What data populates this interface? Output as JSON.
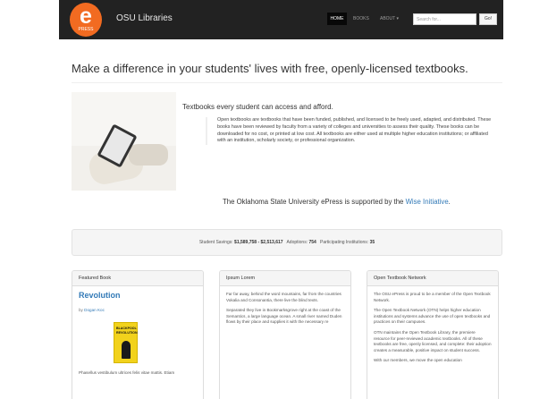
{
  "navbar": {
    "logo_letter": "e",
    "logo_sub": "PRESS",
    "brand": "OSU Libraries",
    "links": [
      "HOME",
      "BOOKS",
      "ABOUT ▾"
    ],
    "search_placeholder": "Search for...",
    "search_button": "Go!",
    "colors": {
      "bar": "#222222",
      "logo": "#f26b21"
    }
  },
  "hero": {
    "headline": "Make a difference in your students' lives with free, openly-licensed textbooks.",
    "subheading": "Textbooks every student can access and afford.",
    "description": "Open textbooks are textbooks that have been funded, published, and licensed to be freely used, adapted, and distributed. These books have been reviewed by faculty from a variety of colleges and universities to assess their quality. These books can be downloaded for no cost, or printed at low cost. All textbooks are either used at multiple higher education institutions; or affiliated with an institution, scholarly society, or professional organization.",
    "support_text": "The Oklahoma State University ePress is supported by the",
    "support_link": "Wise Initiative",
    "support_end": ".",
    "image_icon": "tablet-reader-photo"
  },
  "stats": {
    "savings_label": "Student Savings:",
    "savings_value": "$1,589,758 - $2,513,617",
    "adoptions_label": "Adoptions:",
    "adoptions_value": "754",
    "institutions_label": "Participating Institutions:",
    "institutions_value": "35"
  },
  "panels": {
    "featured": {
      "heading": "Featured Book",
      "book_title": "Revolution",
      "by": "by",
      "author": "Dogan Koc",
      "cover_text": "BLACKPOOL REVOLUTION",
      "blurb": "Phasellus vestibulum ultrices felis vitae mattis. Etiam"
    },
    "ipsum": {
      "heading": "Ipsum Lorem",
      "para1": "Far far away, behind the word mountains, far from the countries Vokalia and Consonantia, there live the blind texts.",
      "para2": "Separated they live in Bookmarksgrove right at the coast of the Semantics, a large language ocean. A small river named Duden flows by their place and supplies it with the necessary re"
    },
    "network": {
      "heading": "Open Textbook Network",
      "para1": "The OSU ePress is proud to be a member of the Open Textbook Network.",
      "para2": "The Open Textbook Network (OTN) helps higher education institutions and systems advance the use of open textbooks and practices on their campuses.",
      "para3": "OTN maintains the Open Textbook Library, the premiere resource for peer-reviewed academic textbooks. All of these textbooks are free, openly licensed, and complete: their adoption creates a measurable, positive impact on student success.",
      "para4": "With our members, we move the open education"
    }
  }
}
